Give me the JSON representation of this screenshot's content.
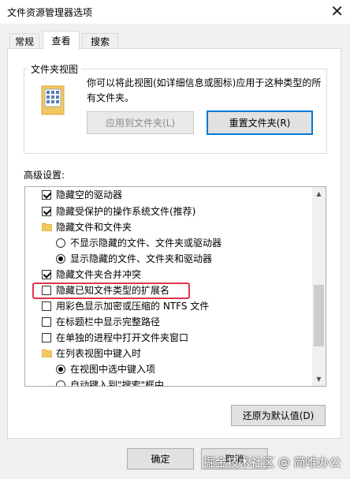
{
  "window": {
    "title": "文件资源管理器选项",
    "close_glyph": "✕"
  },
  "tabs": [
    {
      "label": "常规"
    },
    {
      "label": "查看"
    },
    {
      "label": "搜索"
    }
  ],
  "folder_view": {
    "legend": "文件夹视图",
    "description": "你可以将此视图(如详细信息或图标)应用于这种类型的所有文件夹。",
    "apply_button": "应用到文件夹(L)",
    "reset_button": "重置文件夹(R)"
  },
  "advanced": {
    "label": "高级设置:",
    "items": [
      {
        "kind": "checkbox",
        "checked": true,
        "text": "隐藏空的驱动器"
      },
      {
        "kind": "checkbox",
        "checked": true,
        "text": "隐藏受保护的操作系统文件(推荐)"
      },
      {
        "kind": "folder",
        "text": "隐藏文件和文件夹"
      },
      {
        "kind": "radio",
        "checked": false,
        "text": "不显示隐藏的文件、文件夹或驱动器"
      },
      {
        "kind": "radio",
        "checked": true,
        "text": "显示隐藏的文件、文件夹和驱动器"
      },
      {
        "kind": "checkbox",
        "checked": true,
        "text": "隐藏文件夹合并冲突"
      },
      {
        "kind": "checkbox",
        "checked": false,
        "text": "隐藏已知文件类型的扩展名"
      },
      {
        "kind": "checkbox",
        "checked": false,
        "text": "用彩色显示加密或压缩的 NTFS 文件"
      },
      {
        "kind": "checkbox",
        "checked": false,
        "text": "在标题栏中显示完整路径"
      },
      {
        "kind": "checkbox",
        "checked": false,
        "text": "在单独的进程中打开文件夹窗口"
      },
      {
        "kind": "folder",
        "text": "在列表视图中键入时"
      },
      {
        "kind": "radio",
        "checked": true,
        "text": "在视图中选中键入项"
      },
      {
        "kind": "radio",
        "checked": false,
        "text": "自动键入到\"搜索\"框中"
      }
    ],
    "restore_button": "还原为默认值(D)"
  },
  "footer": {
    "ok_button": "确定",
    "cancel_button": "取消"
  },
  "watermark": "掘金技术社区 @ 简唯办公",
  "colors": {
    "highlight": "#e0354b",
    "focus": "#0078d7"
  }
}
